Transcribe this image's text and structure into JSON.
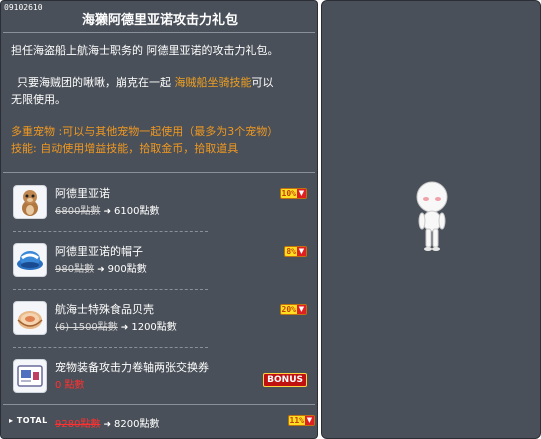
{
  "item_id": "09102610",
  "title": "海獭阿德里亚诺攻击力礼包",
  "description": {
    "line1": "担任海盗船上航海士职务的 阿德里亚诺的攻击力礼包。",
    "line2_pre": "只要海贼团的啾啾，崩克在一起 ",
    "line2_hl": "海贼船坐骑技能",
    "line2_post": "可以",
    "line3": "无限使用。",
    "multi_pet": "多重宠物 :可以与其他宠物一起使用（最多为3个宠物）",
    "skill": "技能: 自动使用增益技能，拾取金币，拾取道具"
  },
  "items": [
    {
      "name": "阿德里亚诺",
      "old_price": "6800點數",
      "new_price": "6100點數",
      "discount": "10%",
      "icon": "otter-pet-icon"
    },
    {
      "name": "阿德里亚诺的帽子",
      "old_price": "980點數",
      "new_price": "900點數",
      "discount": "8%",
      "icon": "hat-icon"
    },
    {
      "name": "航海士特殊食品贝壳",
      "old_price": "(6) 1500點數",
      "new_price": "1200點數",
      "discount": "20%",
      "icon": "shell-food-icon"
    },
    {
      "name": "宠物装备攻击力卷轴两张交换券",
      "price": "0 點數",
      "bonus": "BONUS",
      "icon": "scroll-coupon-icon"
    }
  ],
  "total": {
    "label": "TOTAL",
    "old_price": "9280點數",
    "new_price": "8200點數",
    "discount": "11%"
  },
  "colors": {
    "panel_bg": "#4a5059",
    "highlight": "#f0a020",
    "discount_badge": "#ffe020",
    "bonus_red": "#c01010"
  }
}
